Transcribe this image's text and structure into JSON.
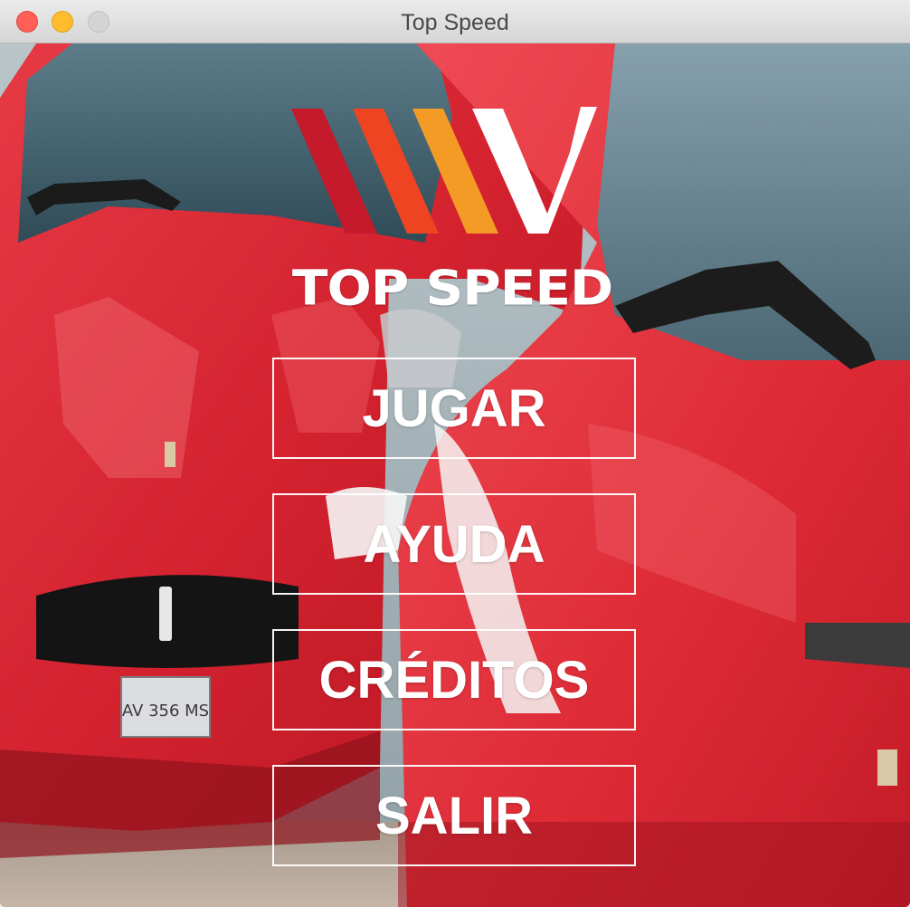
{
  "window": {
    "title": "Top Speed"
  },
  "logo": {
    "text": "TOP SPEED",
    "stripe_colors": [
      "#c41a2c",
      "#ee4422",
      "#f49b26",
      "#ffffff"
    ]
  },
  "menu": {
    "play_label": "JUGAR",
    "help_label": "AYUDA",
    "credits_label": "CRÉDITOS",
    "exit_label": "SALIR"
  },
  "background": {
    "description_icon": "red-sports-cars-photo"
  }
}
